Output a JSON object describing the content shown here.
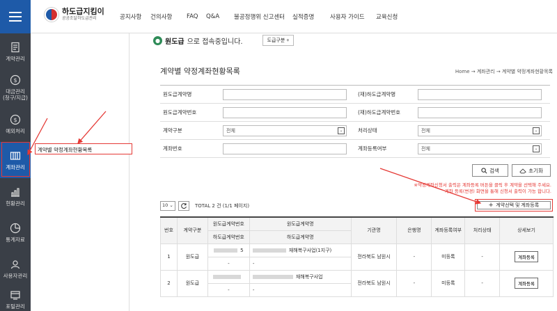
{
  "header": {
    "logo_main": "하도급지킴이",
    "logo_sub": "공공조달하도급관리",
    "nav": [
      "공지사항",
      "건의사항",
      "FAQ",
      "Q&A",
      "불공정행위 신고센터",
      "실적증명",
      "사용자 가이드",
      "교육신청"
    ]
  },
  "sidebar": {
    "items": [
      {
        "label": "계약관리",
        "icon": "document-icon"
      },
      {
        "label": "대금관리\n(청구/지급)",
        "icon": "money-icon"
      },
      {
        "label": "예외처리",
        "icon": "money-exception-icon"
      },
      {
        "label": "계좌관리",
        "icon": "account-book-icon",
        "active": true
      },
      {
        "label": "현황관리",
        "icon": "bar-chart-icon"
      },
      {
        "label": "통계자료",
        "icon": "pie-chart-icon"
      },
      {
        "label": "사용자관리",
        "icon": "user-settings-icon"
      },
      {
        "label": "포털관리",
        "icon": "portal-icon"
      }
    ]
  },
  "submenu": {
    "item": "계약별 약정계좌현황목록"
  },
  "connection": {
    "name": "원도급",
    "text": "으로 접속중입니다.",
    "gubun_button": "도급구분 +"
  },
  "page": {
    "title": "계약별 약정계좌현황목록",
    "breadcrumb": "Home → 계좌관리 → 계약별 약정계좌현황목록"
  },
  "search": {
    "rows": [
      {
        "label1": "원도급계약명",
        "value1": "",
        "type1": "input",
        "label2": "(재)하도급계약명",
        "value2": "",
        "type2": "input"
      },
      {
        "label1": "원도급계약번호",
        "value1": "",
        "type1": "input",
        "label2": "(재)하도급계약번호",
        "value2": "",
        "type2": "input"
      },
      {
        "label1": "계약구분",
        "value1": "전체",
        "type1": "select",
        "label2": "처리상태",
        "value2": "전체",
        "type2": "select"
      },
      {
        "label1": "계좌번호",
        "value1": "",
        "type1": "input",
        "label2": "계좌등록여부",
        "value2": "전체",
        "type2": "select"
      }
    ],
    "search_button": "검색",
    "reset_button": "초기화"
  },
  "notice": {
    "line1": "※약정계좌신청서 출력은 계좌등록 버튼을 클릭 후 계약을 선택해 주세요.",
    "line2": "계좌 등록(변경) 화면을 통해 신청서 출력이 가능 합니다."
  },
  "list": {
    "page_size": "10",
    "total": "TOTAL 2 건 (1/1 페이지)",
    "contract_button": "계약선택 및 계좌등록",
    "headers": {
      "no": "번호",
      "type": "계약구분",
      "orig_no": "원도급계약번호",
      "orig_name": "원도급계약명",
      "sub_no": "하도급계약번호",
      "sub_name": "하도급계약명",
      "agency": "기관명",
      "bank": "은행명",
      "reg": "계좌등록여부",
      "status": "처리상태",
      "detail": "상세보기"
    },
    "rows": [
      {
        "no": "1",
        "type": "원도급",
        "orig_no_tail": "5",
        "orig_name": "재해복구사업(1지구)",
        "sub_no": "-",
        "sub_name": "-",
        "agency": "전라북도 남원시",
        "bank": "-",
        "reg": "미등록",
        "status": "-",
        "detail": "계좌등록"
      },
      {
        "no": "2",
        "type": "원도급",
        "orig_no_tail": "",
        "orig_name": "재해복구사업",
        "sub_no": "-",
        "sub_name": "-",
        "agency": "전라북도 남원시",
        "bank": "-",
        "reg": "미등록",
        "status": "-",
        "detail": "계좌등록"
      }
    ]
  },
  "colors": {
    "brand": "#1e5aa8",
    "sidebar": "#3a3f47",
    "annotation": "#e53935"
  }
}
